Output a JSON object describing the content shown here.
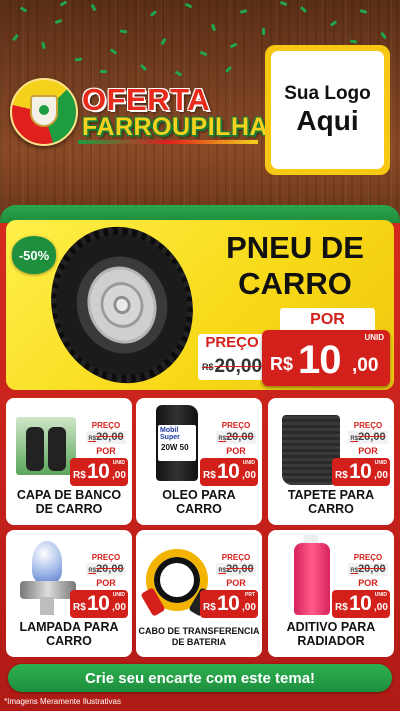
{
  "header": {
    "title_line1": "OFERTA",
    "title_line2": "FARROUPILHA",
    "logo_line1": "Sua Logo",
    "logo_line2": "Aqui"
  },
  "featured": {
    "discount": "-50%",
    "title": "PNEU DE CARRO",
    "old_label": "PREÇO",
    "old_currency": "R$",
    "old_price": "20,00",
    "new_label": "POR",
    "new_currency": "R$",
    "new_int": "10",
    "new_dec": ",00",
    "unit": "UNID",
    "image_icon": "tire-icon"
  },
  "products": [
    {
      "name": "CAPA DE BANCO DE CARRO",
      "old_label": "PREÇO",
      "old_currency": "R$",
      "old_price": "20,00",
      "new_label": "POR",
      "new_currency": "R$",
      "new_int": "10",
      "new_dec": ",00",
      "unit": "UNID",
      "icon": "seat-cover-icon"
    },
    {
      "name": "OLEO PARA CARRO",
      "old_label": "PREÇO",
      "old_currency": "R$",
      "old_price": "20,00",
      "new_label": "POR",
      "new_currency": "R$",
      "new_int": "10",
      "new_dec": ",00",
      "unit": "UNID",
      "icon": "oil-can-icon",
      "brand_text": "Mobil Super",
      "viscosity": "20W 50"
    },
    {
      "name": "TAPETE PARA CARRO",
      "old_label": "PREÇO",
      "old_currency": "R$",
      "old_price": "20,00",
      "new_label": "POR",
      "new_currency": "R$",
      "new_int": "10",
      "new_dec": ",00",
      "unit": "UNID",
      "icon": "car-mat-icon"
    },
    {
      "name": "LAMPADA PARA CARRO",
      "old_label": "PREÇO",
      "old_currency": "R$",
      "old_price": "20,00",
      "new_label": "POR",
      "new_currency": "R$",
      "new_int": "10",
      "new_dec": ",00",
      "unit": "UNID",
      "icon": "headlight-bulb-icon"
    },
    {
      "name": "CABO DE TRANSFERENCIA DE BATERIA",
      "old_label": "PREÇO",
      "old_currency": "R$",
      "old_price": "20,00",
      "new_label": "POR",
      "new_currency": "R$",
      "new_int": "10",
      "new_dec": ",00",
      "unit": "PRT",
      "icon": "jumper-cable-icon"
    },
    {
      "name": "ADITIVO PARA RADIADOR",
      "old_label": "PREÇO",
      "old_currency": "R$",
      "old_price": "20,00",
      "new_label": "POR",
      "new_currency": "R$",
      "new_int": "10",
      "new_dec": ",00",
      "unit": "UNID",
      "icon": "coolant-bottle-icon"
    }
  ],
  "cta": "Crie seu encarte com este tema!",
  "disclaimer": "*Imagens Meramente Ilustrativas",
  "colors": {
    "accent_red": "#d4201a",
    "green": "#1d8f3d",
    "yellow": "#f7d816",
    "wood": "#7a4122"
  }
}
